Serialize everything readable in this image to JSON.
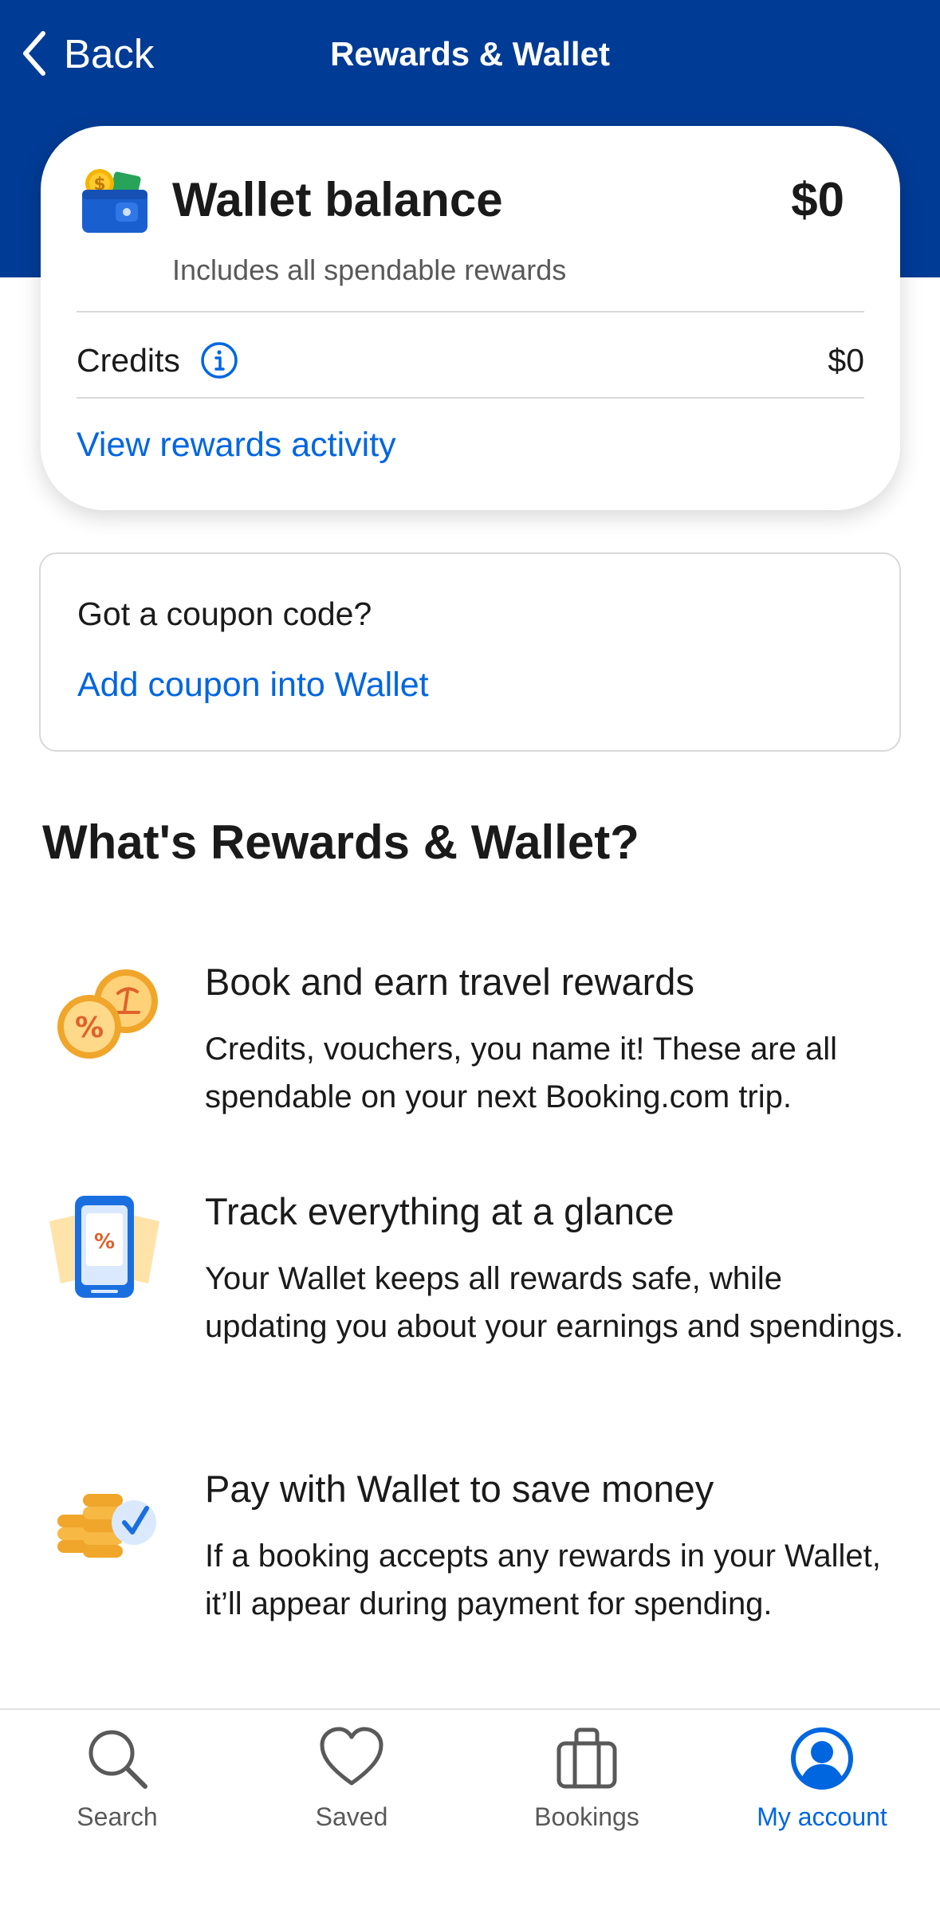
{
  "header": {
    "back_label": "Back",
    "title": "Rewards & Wallet"
  },
  "wallet": {
    "title": "Wallet balance",
    "amount": "$0",
    "subtitle": "Includes all spendable rewards",
    "credits_label": "Credits",
    "credits_value": "$0",
    "activity_link": "View rewards activity"
  },
  "coupon": {
    "question": "Got a coupon code?",
    "link": "Add coupon into Wallet"
  },
  "section": {
    "heading": "What's Rewards & Wallet?"
  },
  "features": [
    {
      "icon": "coins-icon",
      "title": "Book and earn travel rewards",
      "description": "Credits, vouchers, you name it! These are all spendable on your next Booking.com trip."
    },
    {
      "icon": "phone-voucher-icon",
      "title": "Track everything at a glance",
      "description": "Your Wallet keeps all rewards safe, while updating you about your earnings and spendings."
    },
    {
      "icon": "coin-stack-check-icon",
      "title": "Pay with Wallet to save money",
      "description": "If a booking accepts any rewards in your Wallet, it’ll appear during payment for spending."
    }
  ],
  "tabbar": {
    "tabs": [
      {
        "label": "Search",
        "icon": "search-icon",
        "active": false
      },
      {
        "label": "Saved",
        "icon": "heart-icon",
        "active": false
      },
      {
        "label": "Bookings",
        "icon": "suitcase-icon",
        "active": false
      },
      {
        "label": "My account",
        "icon": "account-icon",
        "active": true
      }
    ]
  },
  "colors": {
    "header_bg": "#003b95",
    "link": "#0066e0",
    "text": "#1a1a1a",
    "muted": "#595959"
  }
}
